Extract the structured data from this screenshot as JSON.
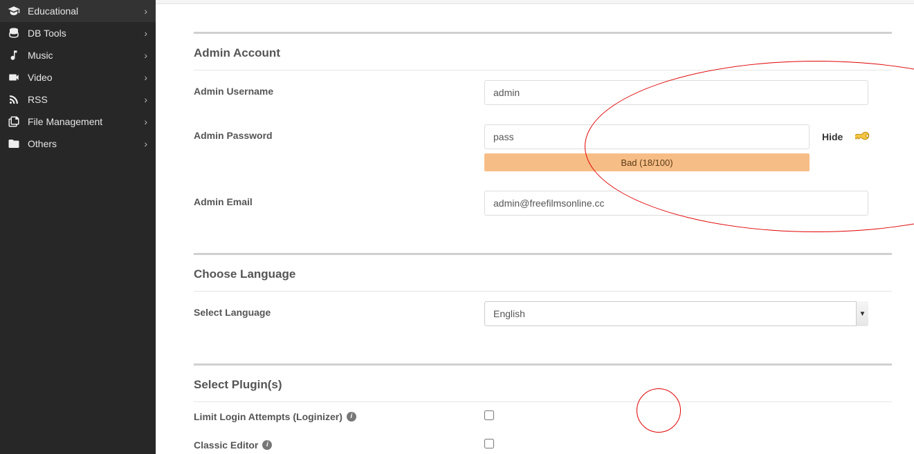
{
  "sidebar": {
    "items": [
      {
        "label": "Educational",
        "icon": "grad-cap-icon"
      },
      {
        "label": "DB Tools",
        "icon": "database-icon"
      },
      {
        "label": "Music",
        "icon": "music-icon"
      },
      {
        "label": "Video",
        "icon": "video-icon"
      },
      {
        "label": "RSS",
        "icon": "rss-icon"
      },
      {
        "label": "File Management",
        "icon": "files-icon"
      },
      {
        "label": "Others",
        "icon": "folder-icon"
      }
    ]
  },
  "sections": {
    "admin": {
      "title": "Admin Account",
      "username_label": "Admin Username",
      "username_value": "admin",
      "password_label": "Admin Password",
      "password_value": "pass",
      "hide_label": "Hide",
      "strength_text": "Bad (18/100)",
      "email_label": "Admin Email",
      "email_value": "admin@freefilmsonline.cc"
    },
    "language": {
      "title": "Choose Language",
      "select_label": "Select Language",
      "selected": "English"
    },
    "plugins": {
      "title": "Select Plugin(s)",
      "items": [
        {
          "label": "Limit Login Attempts (Loginizer)",
          "checked": false
        },
        {
          "label": "Classic Editor",
          "checked": false
        }
      ]
    }
  }
}
